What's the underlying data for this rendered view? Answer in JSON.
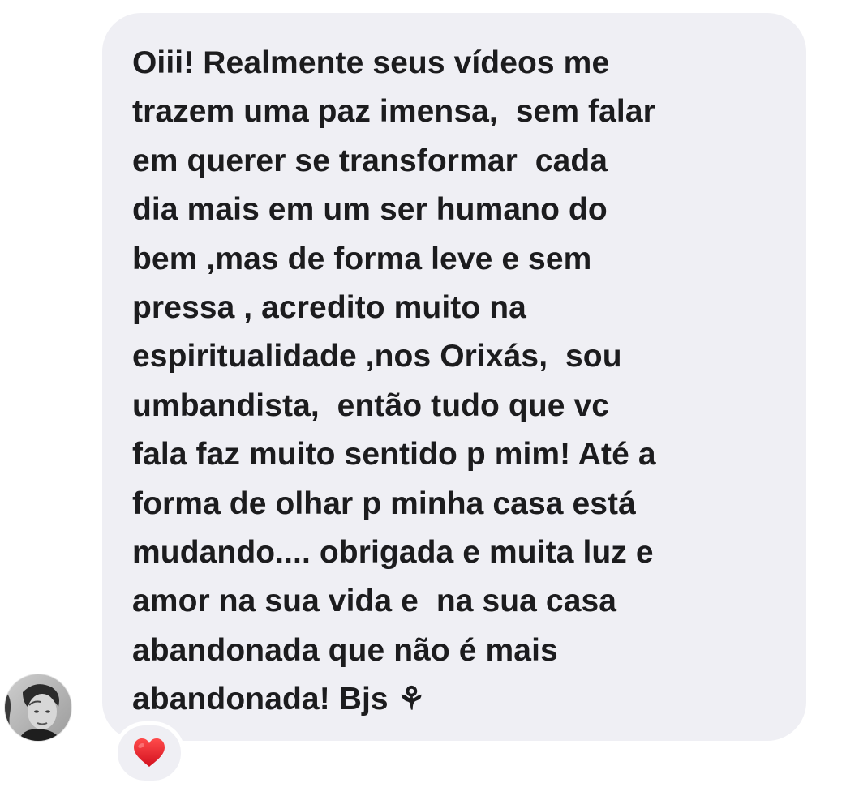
{
  "message": {
    "lines": [
      "Oiii! Realmente seus vídeos me",
      "trazem uma paz imensa,  sem falar",
      "em querer se transformar  cada",
      "dia mais em um ser humano do",
      "bem ,mas de forma leve e sem",
      "pressa , acredito muito na",
      "espiritualidade ,nos Orixás,  sou",
      "umbandista,  então tudo que vc",
      "fala faz muito sentido p mim! Até a",
      "forma de olhar p minha casa está",
      "mudando.... obrigada e muita luz e",
      "amor na sua vida e  na sua casa",
      "abandonada que não é mais",
      "abandonada! Bjs ⚘"
    ]
  },
  "reaction": {
    "icon": "red-heart-icon",
    "color": "#e0202e"
  },
  "avatar": {
    "icon": "user-avatar-photo"
  },
  "colors": {
    "bubble": "#efeff4",
    "text": "#1c1c1e",
    "background": "#ffffff"
  }
}
